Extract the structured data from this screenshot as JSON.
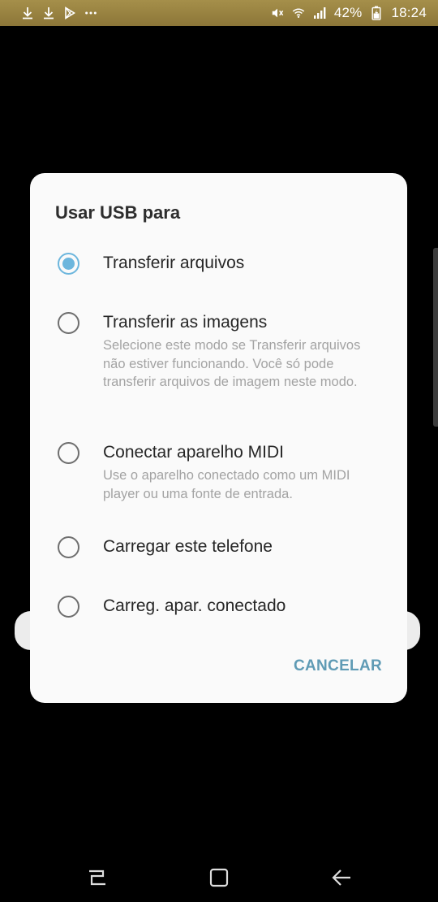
{
  "status_bar": {
    "left_icons": [
      "download-icon",
      "download-icon",
      "play-store-icon",
      "more-dots-icon"
    ],
    "right_icons": [
      "mute-icon",
      "wifi-icon",
      "signal-icon",
      "battery-icon"
    ],
    "battery": "42%",
    "time": "18:24",
    "background_color": "#9a8341"
  },
  "dialog": {
    "title": "Usar USB para",
    "options": [
      {
        "label": "Transferir arquivos",
        "description": "",
        "selected": true
      },
      {
        "label": "Transferir as imagens",
        "description": "Selecione este modo se Transferir arquivos não estiver funcionando. Você só pode transferir arquivos de imagem neste modo.",
        "selected": false
      },
      {
        "label": "Conectar aparelho MIDI",
        "description": "Use o aparelho conectado como um MIDI player ou uma fonte de entrada.",
        "selected": false
      },
      {
        "label": "Carregar este telefone",
        "description": "",
        "selected": false
      },
      {
        "label": "Carreg. apar. conectado",
        "description": "",
        "selected": false
      }
    ],
    "cancel_label": "CANCELAR",
    "accent_color": "#6cb6dd"
  },
  "nav_bar": {
    "icons": [
      "recent-apps-icon",
      "home-icon",
      "back-icon"
    ]
  }
}
